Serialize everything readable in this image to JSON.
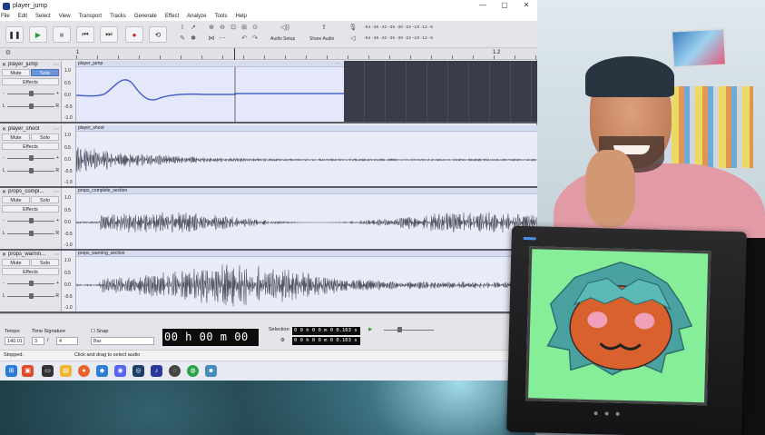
{
  "window": {
    "title": "player_jump",
    "controls": [
      "—",
      "▢",
      "✕"
    ]
  },
  "menu": [
    "File",
    "Edit",
    "Select",
    "View",
    "Transport",
    "Tracks",
    "Generate",
    "Effect",
    "Analyze",
    "Tools",
    "Help"
  ],
  "toolbar": {
    "audio_setup_label": "Audio Setup",
    "share_audio_label": "Share Audio",
    "meter_scale": "-54 -48 -42 -36 -30 -24 -18 -12 -6",
    "meter_scale_2": "-54 -48 -42 -36 -30 -24 -18 -12 -6"
  },
  "ruler": {
    "labels": [
      "1",
      "1.2"
    ]
  },
  "tracks": [
    {
      "name": "player_jump",
      "clip": "player_jump",
      "mute": "Mute",
      "solo": "Solo",
      "solo_active": true,
      "effects": "Effects",
      "scale": [
        "1.0",
        "0.5",
        "0.0",
        "-0.5",
        "-1.0"
      ]
    },
    {
      "name": "player_shoot",
      "clip": "player_shoot",
      "mute": "Mute",
      "solo": "Solo",
      "solo_active": false,
      "effects": "Effects",
      "scale": [
        "1.0",
        "0.5",
        "0.0",
        "-0.5",
        "-1.0"
      ]
    },
    {
      "name": "props_compl...",
      "clip": "props_complete_section",
      "mute": "Mute",
      "solo": "Solo",
      "solo_active": false,
      "effects": "Effects",
      "scale": [
        "1.0",
        "0.5",
        "0.0",
        "-0.5",
        "-1.0"
      ]
    },
    {
      "name": "props_warnin...",
      "clip": "props_warning_section",
      "mute": "Mute",
      "solo": "Solo",
      "solo_active": false,
      "effects": "Effects",
      "scale": [
        "1.0",
        "0.5",
        "0.0",
        "-0.5",
        "-1.0"
      ]
    }
  ],
  "bottom": {
    "tempo_label": "Tempo",
    "tempo_value": "140.01",
    "time_sig_label": "Time Signature",
    "time_sig_num": "3",
    "time_sig_sep": "/",
    "time_sig_den": "4",
    "snap_label": "Snap",
    "snap_value": "Bar",
    "time_display": "00 h 00 m 00 s",
    "selection_label": "Selection",
    "selection_start": "0 0 h 0 0 m 0 0.163 s",
    "selection_end": "0 0 h 0 0 m 0 0.163 s"
  },
  "status": {
    "left": "Stopped.",
    "right": "Click and drag to select audio"
  },
  "taskbar": {
    "icons": [
      "start-icon",
      "explorer-icon",
      "terminal-icon",
      "folder-icon",
      "firefox-icon",
      "vscode-icon",
      "discord-icon",
      "steam-icon",
      "audacity-icon",
      "obs-icon",
      "chrome-icon",
      "godot-icon"
    ],
    "tray": "▲"
  },
  "colors": {
    "solo_active": "#6a93d8",
    "waveform": "#555566",
    "jump_wave": "#4a62c8",
    "tv_screen": "#86ee98"
  }
}
